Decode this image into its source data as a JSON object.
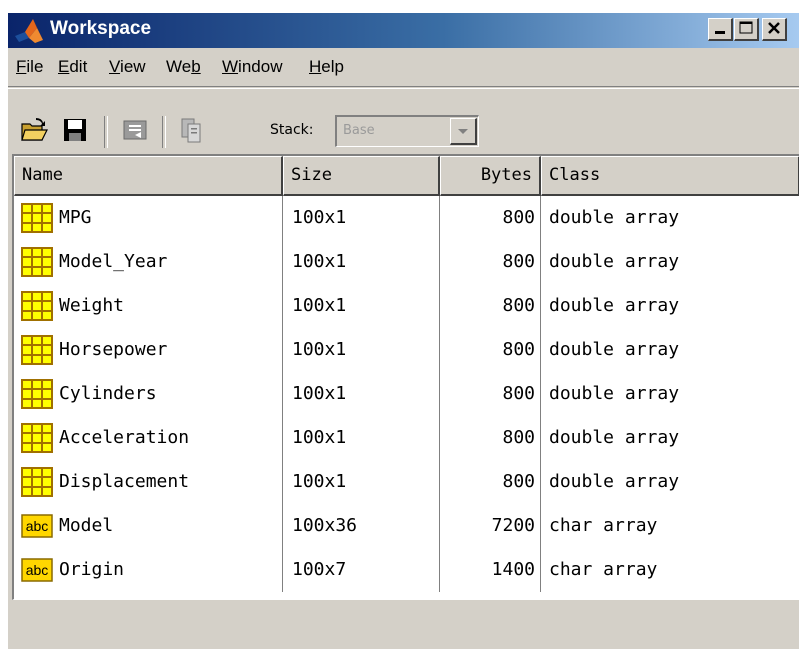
{
  "window": {
    "title": "Workspace",
    "title_icon": "matlab-logo-icon",
    "controls": [
      "_",
      "□",
      "X"
    ]
  },
  "menu": [
    {
      "label": "File"
    },
    {
      "label": "Edit"
    },
    {
      "label": "View"
    },
    {
      "label": "Web"
    },
    {
      "label": "Window"
    },
    {
      "label": "Help"
    }
  ],
  "toolbar": {
    "buttons": [
      "open-folder-icon",
      "save-icon",
      "import-data-icon",
      "delete-icon"
    ],
    "stack_label": "Stack:",
    "stack_value": "Base"
  },
  "table": {
    "columns": [
      "Name",
      "Size",
      "Bytes",
      "Class"
    ],
    "rows": [
      {
        "name": "MPG",
        "size": "100x1",
        "bytes": "800",
        "class": "double array",
        "icon": "matrix-icon"
      },
      {
        "name": "Model_Year",
        "size": "100x1",
        "bytes": "800",
        "class": "double array",
        "icon": "matrix-icon"
      },
      {
        "name": "Weight",
        "size": "100x1",
        "bytes": "800",
        "class": "double array",
        "icon": "matrix-icon"
      },
      {
        "name": "Horsepower",
        "size": "100x1",
        "bytes": "800",
        "class": "double array",
        "icon": "matrix-icon"
      },
      {
        "name": "Cylinders",
        "size": "100x1",
        "bytes": "800",
        "class": "double array",
        "icon": "matrix-icon"
      },
      {
        "name": "Acceleration",
        "size": "100x1",
        "bytes": "800",
        "class": "double array",
        "icon": "matrix-icon"
      },
      {
        "name": "Displacement",
        "size": "100x1",
        "bytes": "800",
        "class": "double array",
        "icon": "matrix-icon"
      },
      {
        "name": "Model",
        "size": "100x36",
        "bytes": "7200",
        "class": "char array",
        "icon": "abc-char-icon"
      },
      {
        "name": "Origin",
        "size": "100x7",
        "bytes": "1400",
        "class": "char array",
        "icon": "abc-char-icon"
      }
    ]
  },
  "colors": {
    "titlebar_start": "#0a246a",
    "titlebar_end": "#a6caf0",
    "face": "#d4d0c8",
    "matrix_icon_fill": "#ffff00",
    "matrix_icon_border": "#a07000"
  }
}
